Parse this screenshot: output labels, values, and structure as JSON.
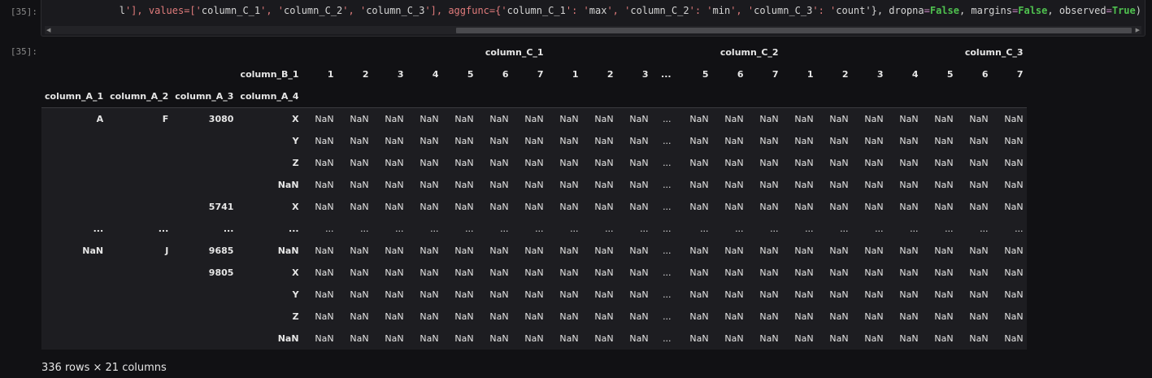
{
  "cells": {
    "input_prompt": "[35]:",
    "output_prompt": "[35]:"
  },
  "code": {
    "line": "l'], values=['column_C_1', 'column_C_2', 'column_C_3'], aggfunc={'column_C_1': 'max', 'column_C_2': 'min', 'column_C_3': 'count'}, dropna=False, margins=False, observed=True)"
  },
  "table": {
    "top_groups": [
      "column_C_1",
      "column_C_2",
      "column_C_3"
    ],
    "col_level_name": "column_B_1",
    "col_labels": [
      "1",
      "2",
      "3",
      "4",
      "5",
      "6",
      "7",
      "1",
      "2",
      "3",
      "...",
      "5",
      "6",
      "7",
      "1",
      "2",
      "3",
      "4",
      "5",
      "6",
      "7"
    ],
    "index_names": [
      "column_A_1",
      "column_A_2",
      "column_A_3",
      "column_A_4"
    ],
    "rows": [
      {
        "idx": [
          "A",
          "F",
          "3080",
          "X"
        ],
        "cell": "NaN"
      },
      {
        "idx": [
          "",
          "",
          "",
          "Y"
        ],
        "cell": "NaN"
      },
      {
        "idx": [
          "",
          "",
          "",
          "Z"
        ],
        "cell": "NaN"
      },
      {
        "idx": [
          "",
          "",
          "",
          "NaN"
        ],
        "cell": "NaN"
      },
      {
        "idx": [
          "",
          "",
          "5741",
          "X"
        ],
        "cell": "NaN"
      },
      {
        "idx": [
          "...",
          "...",
          "...",
          "..."
        ],
        "cell": "..."
      },
      {
        "idx": [
          "NaN",
          "J",
          "9685",
          "NaN"
        ],
        "cell": "NaN"
      },
      {
        "idx": [
          "",
          "",
          "9805",
          "X"
        ],
        "cell": "NaN"
      },
      {
        "idx": [
          "",
          "",
          "",
          "Y"
        ],
        "cell": "NaN"
      },
      {
        "idx": [
          "",
          "",
          "",
          "Z"
        ],
        "cell": "NaN"
      },
      {
        "idx": [
          "",
          "",
          "",
          "NaN"
        ],
        "cell": "NaN"
      }
    ],
    "ellipsis": "...",
    "shape": "336 rows × 21 columns"
  }
}
